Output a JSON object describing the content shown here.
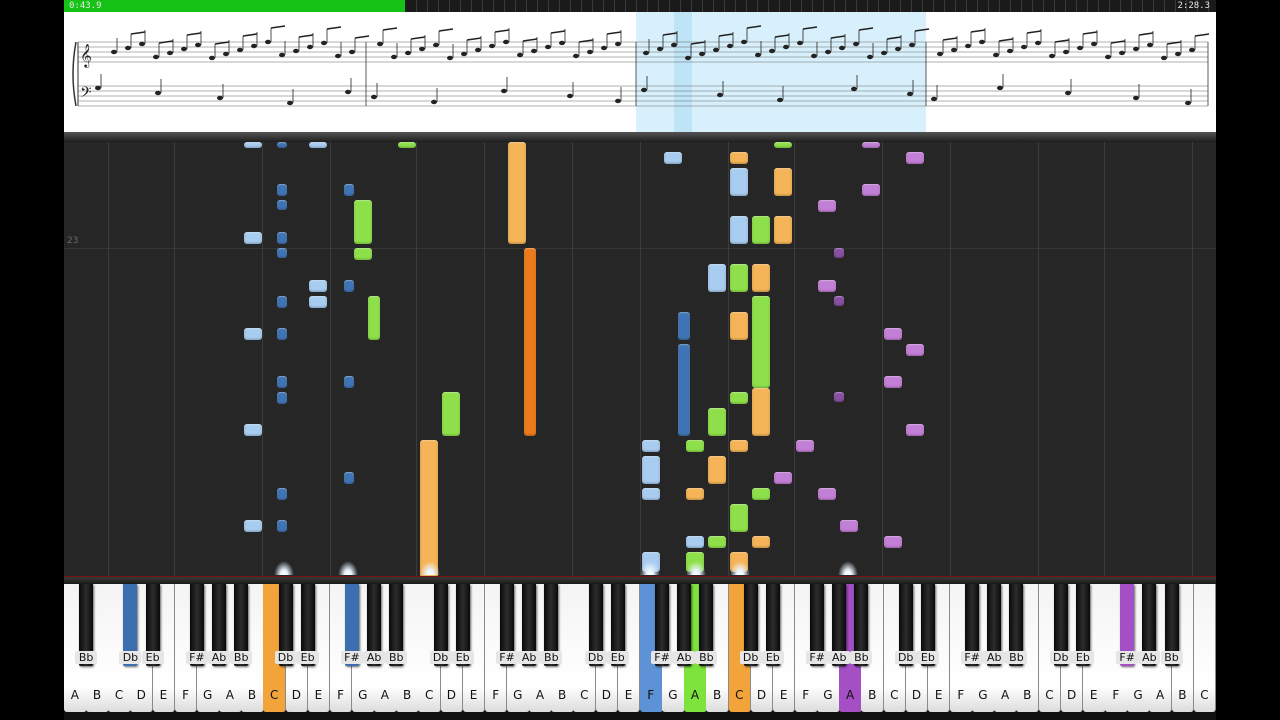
{
  "playback": {
    "time_elapsed": "0:43.9",
    "time_total": "2:28.3",
    "progress": 0.296
  },
  "roll": {
    "measure_number": "23"
  },
  "keyboard": {
    "white_labels": [
      "A",
      "B",
      "C",
      "D",
      "E",
      "F",
      "G",
      "A",
      "B",
      "C",
      "D",
      "E",
      "F",
      "G",
      "A",
      "B",
      "C",
      "D",
      "E",
      "F",
      "G",
      "A",
      "B",
      "C",
      "D",
      "E",
      "F",
      "G",
      "A",
      "B",
      "C",
      "D",
      "E",
      "F",
      "G",
      "A",
      "B",
      "C",
      "D",
      "E",
      "F",
      "G",
      "A",
      "B",
      "C",
      "D",
      "E",
      "F",
      "G",
      "A",
      "B",
      "C"
    ],
    "black_labels": [
      "Bb",
      "Db",
      "Eb",
      "F#",
      "Ab",
      "Bb",
      "Db",
      "Eb",
      "F#",
      "Ab",
      "Bb",
      "Db",
      "Eb",
      "F#",
      "Ab",
      "Bb",
      "Db",
      "Eb",
      "F#",
      "Ab",
      "Bb",
      "Db",
      "Eb",
      "F#",
      "Ab",
      "Bb",
      "Db",
      "Eb",
      "F#",
      "Ab",
      "Bb",
      "Db",
      "Eb",
      "F#",
      "Ab",
      "Bb"
    ],
    "pressed": [
      {
        "key": "Db",
        "color": "#3b6fb0"
      },
      {
        "key": "F#",
        "color": "#3b6fb0"
      },
      {
        "key": "C",
        "color": "#f2a43a"
      },
      {
        "key": "F",
        "color": "#5d93d6"
      },
      {
        "key": "A",
        "color": "#7ee23c"
      },
      {
        "key": "C",
        "color": "#f2a43a"
      },
      {
        "key": "A",
        "color": "#a44fc3"
      }
    ]
  },
  "track_colors": {
    "light_blue": "#a9cdf0",
    "dark_blue": "#3f75b5",
    "green": "#8ee04a",
    "orange": "#f5b457",
    "dark_orange": "#ec7a1c",
    "purple": "#c27fd6",
    "dark_purple": "#8a4ea3"
  }
}
